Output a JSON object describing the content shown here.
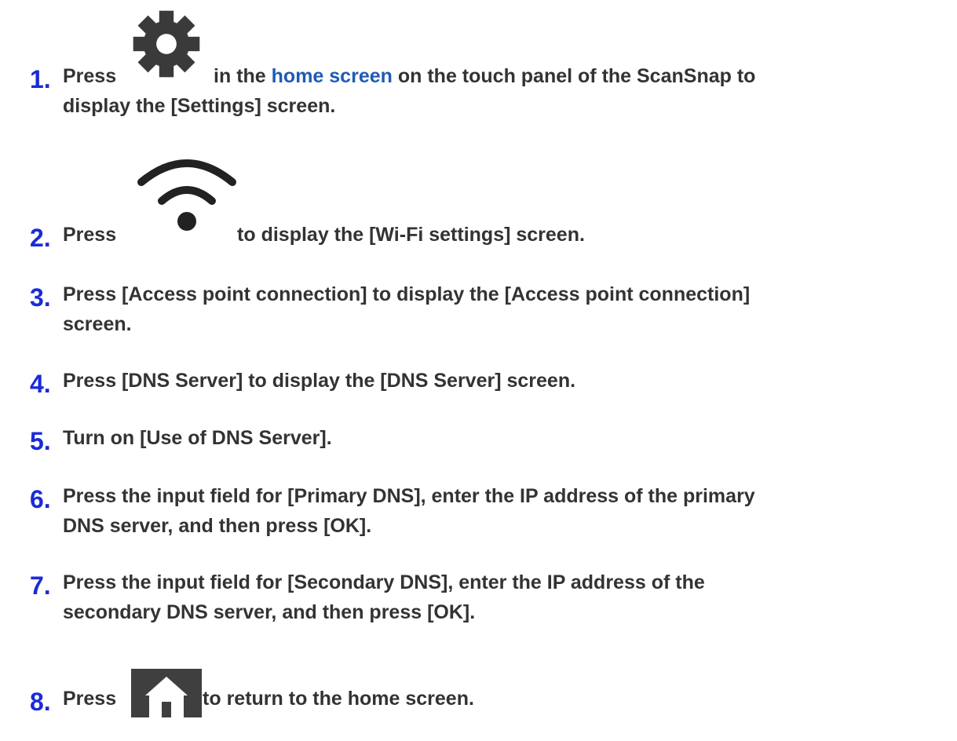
{
  "steps": [
    {
      "number": "1.",
      "parts": {
        "a": "Press",
        "icon": "gear-icon",
        "b": "in the",
        "link": "home screen",
        "c": "on the touch panel of the ScanSnap to",
        "line2": "display the [Settings] screen."
      }
    },
    {
      "number": "2.",
      "parts": {
        "a": "Press",
        "icon": "wifi-icon",
        "b": "to display the [Wi-Fi settings] screen."
      }
    },
    {
      "number": "3.",
      "line1": "Press [Access point connection] to display the [Access point connection]",
      "line2": "screen."
    },
    {
      "number": "4.",
      "line1": "Press [DNS Server] to display the [DNS Server] screen."
    },
    {
      "number": "5.",
      "line1": "Turn on [Use of DNS Server]."
    },
    {
      "number": "6.",
      "line1": "Press the input field for [Primary DNS], enter the IP address of the primary",
      "line2": "DNS server, and then press [OK]."
    },
    {
      "number": "7.",
      "line1": "Press the input field for [Secondary DNS], enter the IP address of the",
      "line2": "secondary DNS server, and then press [OK]."
    },
    {
      "number": "8.",
      "parts": {
        "a": "Press",
        "icon": "home-icon",
        "b": "to return to the home screen."
      }
    }
  ],
  "colors": {
    "step_number": "#1a2bd6",
    "body_text": "#333333",
    "link": "#1f5bb5",
    "icon": "#3a3a3a"
  }
}
